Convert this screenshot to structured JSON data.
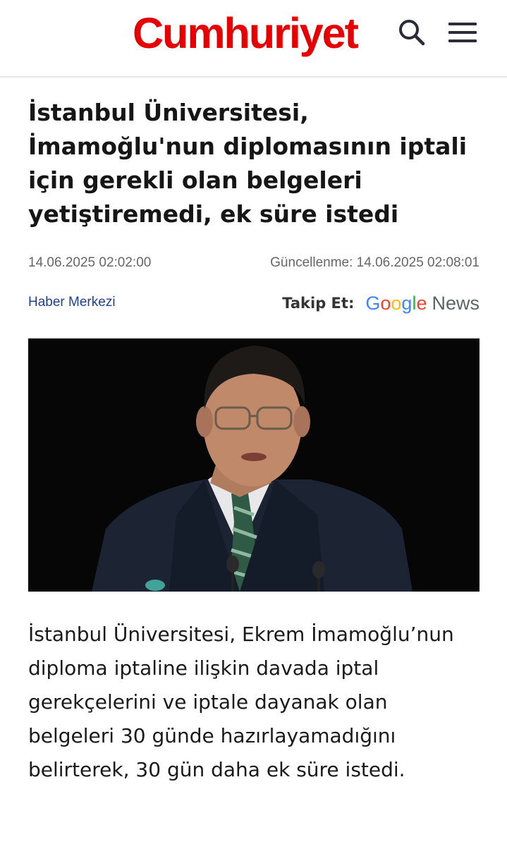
{
  "header": {
    "logo_text": "Cumhuriyet",
    "brand_color": "#e60000",
    "search_icon": "search-icon",
    "menu_icon": "hamburger-menu-icon"
  },
  "article": {
    "headline": "İstanbul Üniversitesi, İmamoğlu'nun diplomasının iptali için gerekli olan belgeleri yetiştiremedi, ek süre istedi",
    "published": "14.06.2025 02:02:00",
    "updated": "Güncellenme: 14.06.2025 02:08:01",
    "author": "Haber Merkezi",
    "follow_label": "Takip Et:",
    "google_news": {
      "g1": "G",
      "g2": "o",
      "g3": "o",
      "g4": "g",
      "g5": "l",
      "g6": "e",
      "news": "News"
    },
    "lead": "İstanbul Üniversitesi, Ekrem İmamoğlu’nun diploma iptaline ilişkin davada iptal gerekçelerini ve iptale dayanak olan belgeleri 30 günde hazırlayamadığını belirterek, 30 gün daha ek süre istedi."
  }
}
